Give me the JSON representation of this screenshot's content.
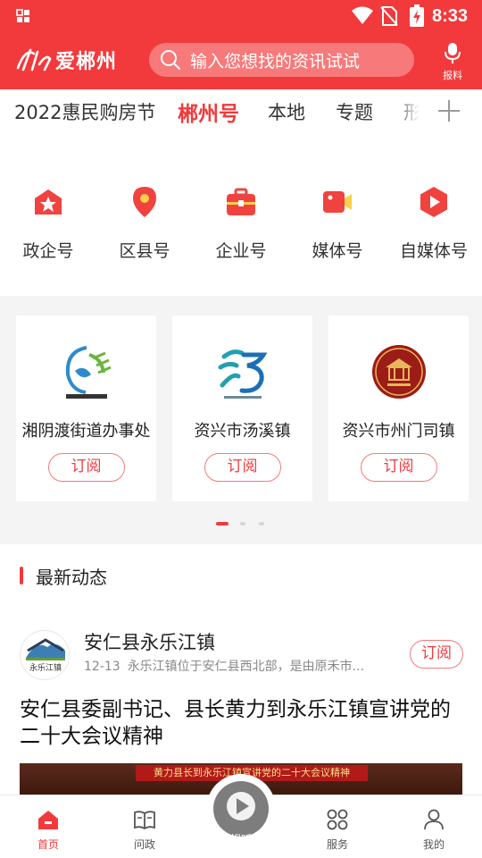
{
  "status_bar": {
    "time": "8:33"
  },
  "header": {
    "logo_text": "爱郴州",
    "search_placeholder": "输入您想找的资讯试试",
    "report_label": "报料"
  },
  "tabs": [
    {
      "label": "2022惠民购房节",
      "active": false
    },
    {
      "label": "郴州号",
      "active": true
    },
    {
      "label": "本地",
      "active": false
    },
    {
      "label": "专题",
      "active": false
    },
    {
      "label": "形",
      "active": false
    }
  ],
  "categories": [
    {
      "label": "政企号",
      "icon": "government-icon"
    },
    {
      "label": "区县号",
      "icon": "location-pin-icon"
    },
    {
      "label": "企业号",
      "icon": "briefcase-icon"
    },
    {
      "label": "媒体号",
      "icon": "video-camera-icon"
    },
    {
      "label": "自媒体号",
      "icon": "play-icon"
    }
  ],
  "accounts": [
    {
      "name": "湘阴渡街道办事处",
      "subscribe": "订阅"
    },
    {
      "name": "资兴市汤溪镇",
      "subscribe": "订阅"
    },
    {
      "name": "资兴市州门司镇",
      "subscribe": "订阅"
    }
  ],
  "carousel": {
    "pages": 3,
    "current": 0
  },
  "latest": {
    "section_title": "最新动态",
    "source_name": "安仁县永乐江镇",
    "date": "12-13",
    "excerpt": "永乐江镇位于安仁县西北部，是由原禾市...",
    "subscribe": "订阅",
    "headline": "安仁县委副书记、县长黄力到永乐江镇宣讲党的二十大会议精神",
    "image_banner": "黄力县长到永乐江镇宣讲党的二十大会议精神"
  },
  "bottom_nav": [
    {
      "label": "首页",
      "icon": "home-icon",
      "active": true
    },
    {
      "label": "问政",
      "icon": "book-icon",
      "active": false
    },
    {
      "label": "视听",
      "icon": "play-circle-icon",
      "active": false
    },
    {
      "label": "服务",
      "icon": "services-icon",
      "active": false
    },
    {
      "label": "我的",
      "icon": "profile-icon",
      "active": false
    }
  ],
  "colors": {
    "brand": "#f23a3c",
    "search_bg": "#f7797a"
  }
}
